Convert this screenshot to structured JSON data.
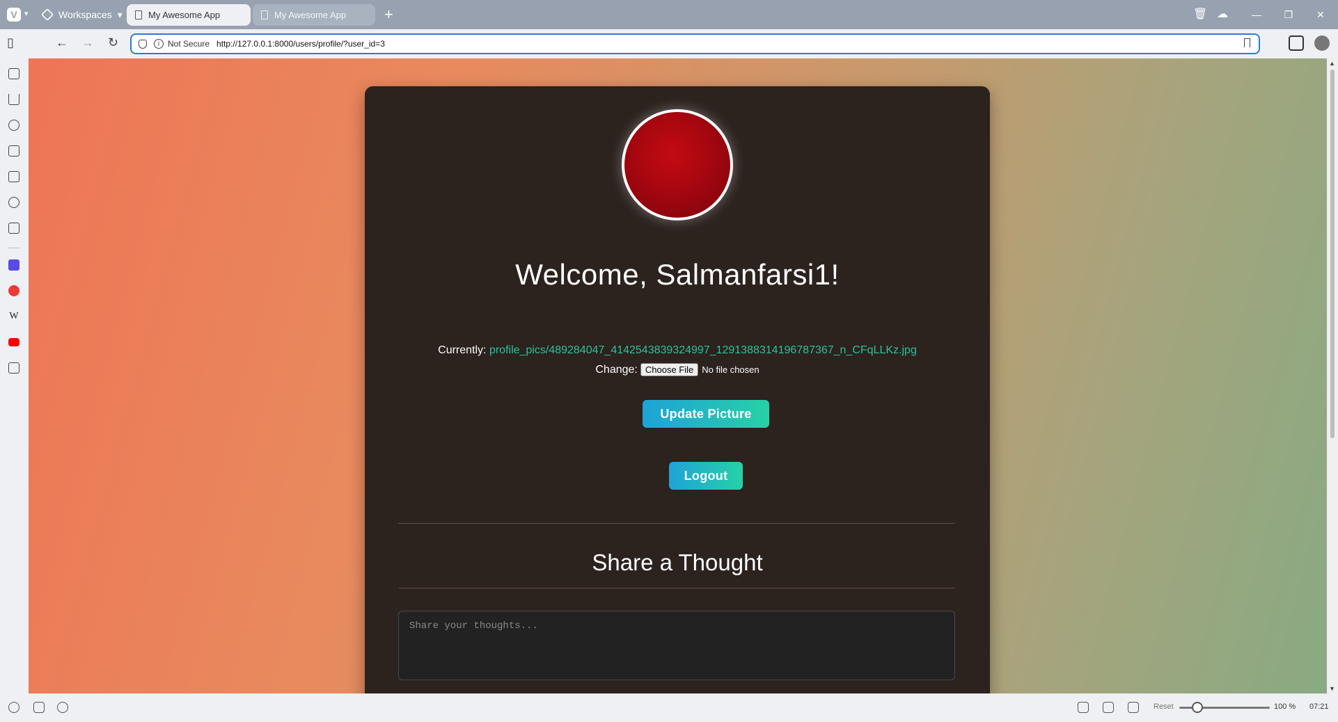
{
  "browser": {
    "workspaces_label": "Workspaces",
    "tabs": [
      {
        "title": "My Awesome App",
        "active": true
      },
      {
        "title": "My Awesome App",
        "active": false
      }
    ],
    "security_label": "Not Secure",
    "url": "http://127.0.0.1:8000/users/profile/?user_id=3",
    "zoom_reset_label": "Reset",
    "zoom_level": "100 %",
    "clock": "07:21"
  },
  "profile": {
    "welcome": "Welcome, Salmanfarsi1!",
    "currently_label": "Currently:",
    "current_picture": "profile_pics/489284047_4142543839324997_1291388314196787367_n_CFqLLKz.jpg",
    "change_label": "Change:",
    "choose_file_label": "Choose File",
    "no_file_label": "No file chosen",
    "update_button": "Update Picture",
    "logout_button": "Logout"
  },
  "thoughts": {
    "title": "Share a Thought",
    "placeholder": "Share your thoughts..."
  },
  "colors": {
    "accent_start": "#1ea3d8",
    "accent_end": "#27d1a6",
    "link": "#2bc49a",
    "card_bg": "#2c221e"
  }
}
